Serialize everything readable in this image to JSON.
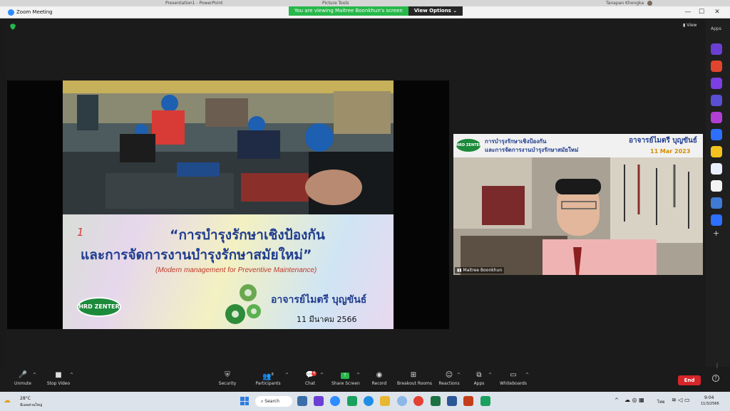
{
  "system_bar": {
    "doc": "Presentation1 - PowerPoint",
    "tools": "Picture Tools",
    "user": "Tanapan Khongka"
  },
  "window": {
    "title": "Zoom Meeting",
    "minimize": "—",
    "maximize": "☐",
    "close": "✕"
  },
  "share_banner": {
    "message": "You are viewing Maitree Boonkhun's screen",
    "view_options": "View Options"
  },
  "top_right": {
    "view": "View",
    "apps": "Apps"
  },
  "slide": {
    "mark": "1",
    "title_line1": "“การบำรุงรักษาเชิงป้องกัน",
    "title_line2": "และการจัดการงานบำรุงรักษาสมัยใหม่”",
    "subtitle": "(Modern management for Preventive Maintenance)",
    "logo": "HRD ZENTER",
    "presenter": "อาจารย์ไมตรี  บุญขันธ์",
    "date": "11 มีนาคม 2566"
  },
  "camera": {
    "header_line1": "การบำรุงรักษาเชิงป้องกัน",
    "header_line2": "และการจัดการงานบำรุงรักษาสมัยใหม่",
    "presenter": "อาจารย์ไมตรี  บุญขันธ์",
    "date": "11 Mar 2023",
    "logo": "HRD ZENTER",
    "name_tag": "Maitree Boonkhun"
  },
  "toolbar": {
    "unmute": "Unmute",
    "stop_video": "Stop Video",
    "security": "Security",
    "participants": "Participants",
    "participants_count": "8",
    "chat": "Chat",
    "chat_badge": "4",
    "share_screen": "Share Screen",
    "record": "Record",
    "breakout": "Breakout Rooms",
    "reactions": "Reactions",
    "apps": "Apps",
    "whiteboards": "Whiteboards",
    "end": "End"
  },
  "taskbar": {
    "temp": "28°C",
    "weather": "มีเมฆส่วนใหญ่",
    "search": "Search",
    "lang": "ไทย",
    "time": "9:04",
    "date": "11/3/2566"
  },
  "colors": {
    "zoom_blue": "#2d8cff",
    "share_green": "#27b84a",
    "end_red": "#d6262a",
    "slide_title": "#1f3c8f",
    "slide_subtitle": "#c0392b",
    "logo_green": "#1c8a3a"
  }
}
